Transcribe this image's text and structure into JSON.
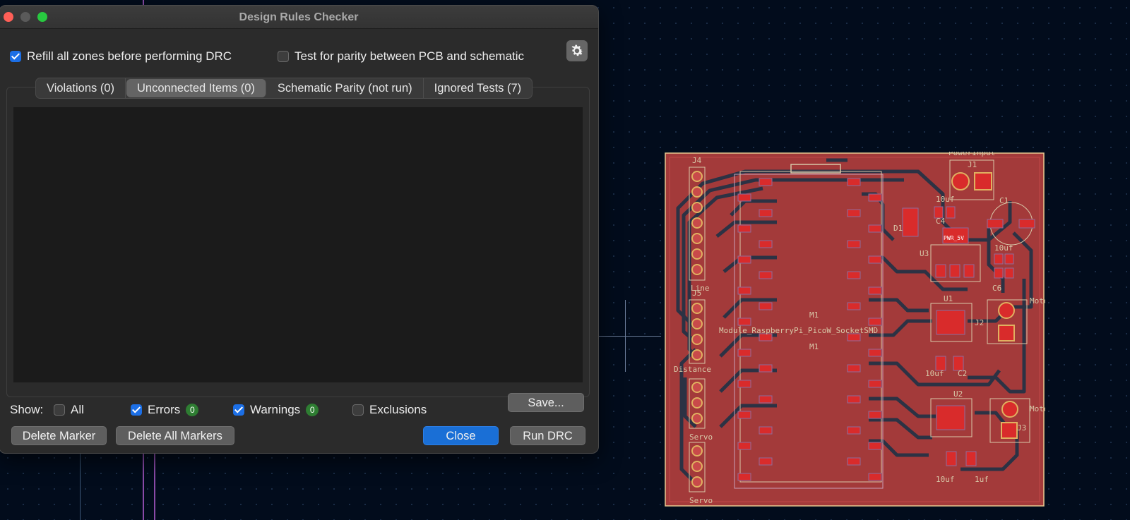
{
  "dialog": {
    "title": "Design Rules Checker",
    "options": {
      "refill_zones": {
        "label": "Refill all zones before performing DRC",
        "checked": true
      },
      "parity_test": {
        "label": "Test for parity between PCB and schematic",
        "checked": false
      }
    },
    "tabs": [
      {
        "label": "Violations (0)",
        "active": false
      },
      {
        "label": "Unconnected Items (0)",
        "active": true
      },
      {
        "label": "Schematic Parity (not run)",
        "active": false
      },
      {
        "label": "Ignored Tests (7)",
        "active": false
      }
    ],
    "show": {
      "label": "Show:",
      "all": {
        "label": "All",
        "checked": false
      },
      "errors": {
        "label": "Errors",
        "checked": true,
        "count": "0"
      },
      "warnings": {
        "label": "Warnings",
        "checked": true,
        "count": "0"
      },
      "exclusions": {
        "label": "Exclusions",
        "checked": false
      }
    },
    "buttons": {
      "save": "Save...",
      "delete_marker": "Delete Marker",
      "delete_all_markers": "Delete All Markers",
      "close": "Close",
      "run_drc": "Run DRC"
    },
    "colors": {
      "accent": "#1a6fd6",
      "badge": "#2e7d32"
    }
  },
  "pcb": {
    "colors": {
      "board": "#a33a3a",
      "edge": "#e8c890",
      "track": "#2c3244",
      "pad": "#d92b2b",
      "silk": "#d8c8a8"
    },
    "labels": {
      "power_input": "PowerInput",
      "j1": "J1",
      "c1": "C1",
      "j4": "J4",
      "line": "Line",
      "j5": "J5",
      "distance": "Distance",
      "servo1": "Servo",
      "servo2": "Servo",
      "m1_top": "M1",
      "m1_bottom": "M1",
      "module": "Module_RaspberryPi_PicoW_SocketSMD",
      "d1": "D1",
      "c4": "C4",
      "c4_val": "10uf",
      "pwr": "PWR_5V",
      "u3": "U3",
      "c6_val": "10uf",
      "c6": "C6",
      "u1": "U1",
      "j2": "J2",
      "motor_r": "MotorR",
      "c2": "C2",
      "c2_val": "10uf",
      "u2": "U2",
      "j3": "J3",
      "motor_l": "MotorL",
      "c_val3": "10uf",
      "c_val4": "1uf"
    }
  }
}
